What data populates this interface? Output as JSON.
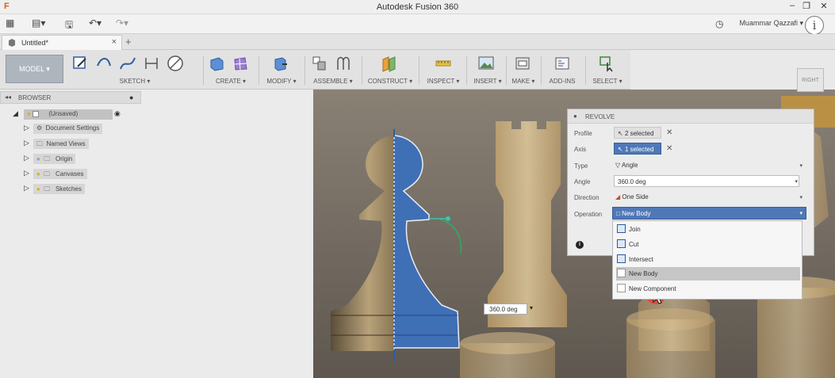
{
  "window": {
    "title": "Autodesk Fusion 360",
    "logo": "F"
  },
  "quickbar": {
    "user_name": "Muammar Qazzafi",
    "info_symbol": "i"
  },
  "tabs": [
    {
      "label": "Untitled*"
    }
  ],
  "toolbar": {
    "workspace": "MODEL",
    "groups": [
      {
        "label": "SKETCH"
      },
      {
        "label": "CREATE"
      },
      {
        "label": "MODIFY"
      },
      {
        "label": "ASSEMBLE"
      },
      {
        "label": "CONSTRUCT"
      },
      {
        "label": "INSPECT"
      },
      {
        "label": "INSERT"
      },
      {
        "label": "MAKE"
      },
      {
        "label": "ADD-INS"
      },
      {
        "label": "SELECT"
      }
    ]
  },
  "browser": {
    "title": "BROWSER",
    "root": "(Unsaved)",
    "items": [
      {
        "label": "Document Settings",
        "icon": "gear-icon"
      },
      {
        "label": "Named Views",
        "icon": "folder-icon"
      },
      {
        "label": "Origin",
        "icon": "folder-icon"
      },
      {
        "label": "Canvases",
        "icon": "folder-icon"
      },
      {
        "label": "Sketches",
        "icon": "folder-icon"
      }
    ]
  },
  "revolve": {
    "title": "REVOLVE",
    "rows": [
      {
        "label": "Profile",
        "value": "2 selected"
      },
      {
        "label": "Axis",
        "value": "1 selected"
      },
      {
        "label": "Type",
        "value": "Angle"
      },
      {
        "label": "Angle",
        "value": "360.0 deg"
      },
      {
        "label": "Direction",
        "value": "One Side"
      },
      {
        "label": "Operation",
        "value": "New Body"
      }
    ],
    "operation_options": [
      {
        "label": "Join"
      },
      {
        "label": "Cut"
      },
      {
        "label": "Intersect"
      },
      {
        "label": "New Body"
      },
      {
        "label": "New Component"
      }
    ]
  },
  "viewport": {
    "angle_value": "360.0 deg",
    "viewcube_face": "RIGHT"
  },
  "colors": {
    "accent": "#4f78b8",
    "selected_row": "#c6c6c6",
    "cursor_highlight": "#e8413a"
  }
}
